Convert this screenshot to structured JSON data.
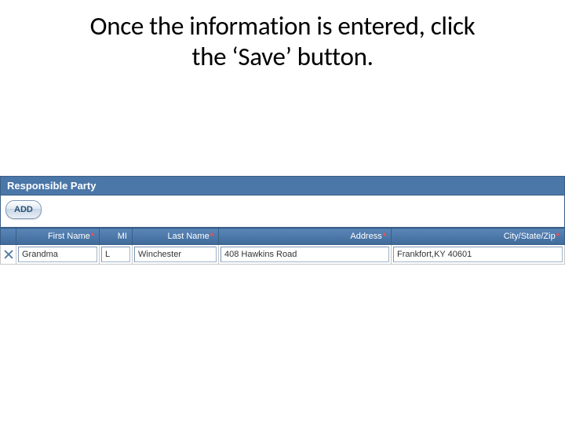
{
  "instruction": {
    "line1": "Once the information is entered, click",
    "line2": "the ‘Save’ button."
  },
  "section": {
    "title": "Responsible Party",
    "add_label": "ADD"
  },
  "grid": {
    "headers": {
      "first_name": "First Name",
      "mi": "MI",
      "last_name": "Last Name",
      "address": "Address",
      "city_state_zip": "City/State/Zip",
      "required_mark": "*"
    },
    "row": {
      "first_name": "Grandma",
      "mi": "L",
      "last_name": "Winchester",
      "address": "408 Hawkins Road",
      "city_state_zip": "Frankfort,KY 40601"
    }
  }
}
